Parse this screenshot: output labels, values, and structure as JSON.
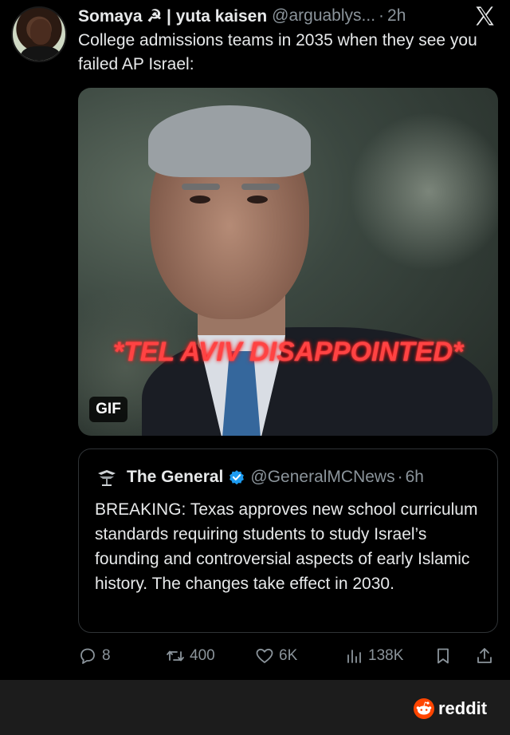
{
  "tweet": {
    "display_name": "Somaya ☭ | yuta kaisen",
    "handle": "@arguablys...",
    "separator": "·",
    "time": "2h",
    "text": "College admissions teams in 2035 when they see you failed AP Israel:",
    "media": {
      "caption": "*TEL AVIV DISAPPOINTED*",
      "badge": "GIF"
    }
  },
  "quote": {
    "display_name": "The General",
    "handle": "@GeneralMCNews",
    "separator": "·",
    "time": "6h",
    "text": "BREAKING: Texas approves new school curriculum standards requiring students to study Israel’s founding and controversial aspects of early Islamic history. The changes take effect in 2030."
  },
  "actions": {
    "replies": "8",
    "retweets": "400",
    "likes": "6K",
    "views": "138K"
  },
  "footer": {
    "brand": "reddit"
  },
  "colors": {
    "background": "#000000",
    "text": "#e7e9ea",
    "muted": "#8b949b",
    "border": "#2f3336",
    "verified": "#1d9bf0",
    "reddit_orange": "#ff4500",
    "caption_red": "#ff4343"
  },
  "icons": [
    "x-logo-icon",
    "verified-icon",
    "reply-icon",
    "retweet-icon",
    "like-icon",
    "views-icon",
    "bookmark-icon",
    "share-icon",
    "reddit-icon"
  ]
}
